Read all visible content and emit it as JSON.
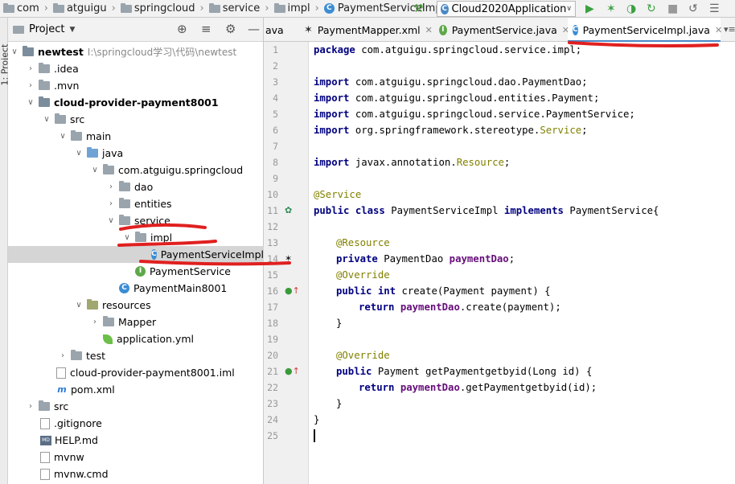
{
  "breadcrumbs": [
    "com",
    "atguigu",
    "springcloud",
    "service",
    "impl",
    "PaymentServiceImpl"
  ],
  "run_config": {
    "label": "Cloud2020Application"
  },
  "side_tool_label": "1: Project",
  "project_panel": {
    "title": "Project"
  },
  "tree": [
    {
      "label": "newtest",
      "path": "I:\\springcloud学习\\代码\\newtest",
      "bold": true
    },
    {
      "label": ".idea"
    },
    {
      "label": ".mvn"
    },
    {
      "label": "cloud-provider-payment8001",
      "bold": true
    },
    {
      "label": "src"
    },
    {
      "label": "main"
    },
    {
      "label": "java"
    },
    {
      "label": "com.atguigu.springcloud"
    },
    {
      "label": "dao"
    },
    {
      "label": "entities"
    },
    {
      "label": "service"
    },
    {
      "label": "impl"
    },
    {
      "label": "PaymentServiceImpl"
    },
    {
      "label": "PaymentService"
    },
    {
      "label": "PaymentMain8001"
    },
    {
      "label": "resources"
    },
    {
      "label": "Mapper"
    },
    {
      "label": "application.yml"
    },
    {
      "label": "test"
    },
    {
      "label": "cloud-provider-payment8001.iml"
    },
    {
      "label": "pom.xml"
    },
    {
      "label": "src"
    },
    {
      "label": ".gitignore"
    },
    {
      "label": "HELP.md"
    },
    {
      "label": "mvnw"
    },
    {
      "label": "mvnw.cmd"
    }
  ],
  "tabs": [
    {
      "label": "ava"
    },
    {
      "label": "PaymentMapper.xml"
    },
    {
      "label": "PaymentService.java"
    },
    {
      "label": "PaymentServiceImpl.java"
    }
  ],
  "line_numbers": [
    "1",
    "2",
    "3",
    "4",
    "5",
    "6",
    "7",
    "8",
    "9",
    "10",
    "11",
    "12",
    "13",
    "14",
    "15",
    "16",
    "17",
    "18",
    "19",
    "20",
    "21",
    "22",
    "23",
    "24",
    "25"
  ],
  "code": {
    "l1_kw": "package",
    "l1_rest": " com.atguigu.springcloud.service.impl;",
    "l3_kw": "import",
    "l3_rest": " com.atguigu.springcloud.dao.PaymentDao;",
    "l4_kw": "import",
    "l4_rest": " com.atguigu.springcloud.entities.Payment;",
    "l5_kw": "import",
    "l5_rest": " com.atguigu.springcloud.service.PaymentService;",
    "l6_kw": "import",
    "l6_rest": " org.springframework.stereotype.",
    "l6_an": "Service",
    "l6_end": ";",
    "l8_kw": "import",
    "l8_rest": " javax.annotation.",
    "l8_an": "Resource",
    "l8_end": ";",
    "l10_an": "@Service",
    "l11_kw1": "public class",
    "l11_mid": " PaymentServiceImpl ",
    "l11_kw2": "implements",
    "l11_end": " PaymentService{",
    "l13_an": "@Resource",
    "l14_kw": "private",
    "l14_mid": " PaymentDao ",
    "l14_fld": "paymentDao",
    "l14_end": ";",
    "l15_an": "@Override",
    "l16_kw1": "public int",
    "l16_end": " create(Payment payment) {",
    "l17_kw": "return",
    "l17_fld": "paymentDao",
    "l17_end": ".create(payment);",
    "l18": "}",
    "l20_an": "@Override",
    "l21_kw": "public",
    "l21_end": " Payment getPaymentgetbyid(Long id) {",
    "l22_kw": "return",
    "l22_fld": "paymentDao",
    "l22_end": ".getPaymentgetbyid(id);",
    "l23": "}",
    "l24": "}"
  },
  "colors": {
    "keyword": "#000080",
    "annotation": "#808000",
    "field": "#660e7a",
    "annotation_mark": "#e02020"
  }
}
